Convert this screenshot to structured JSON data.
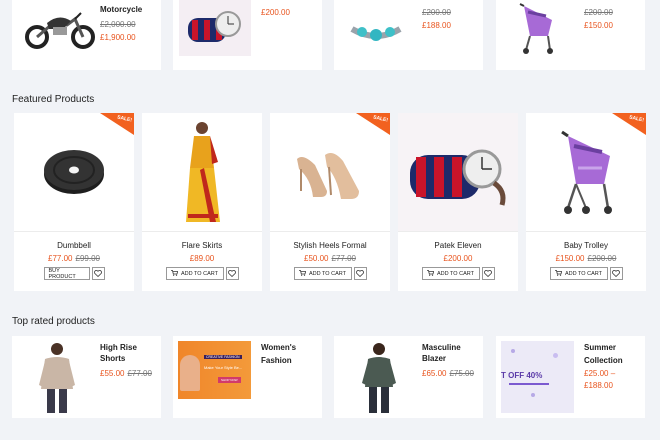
{
  "top_row": [
    {
      "name": "Motorcycle",
      "price": "£1,900.00",
      "old_price": "£2,000.00",
      "icon": "motorcycle"
    },
    {
      "name": "",
      "price": "£200.00",
      "old_price": "",
      "icon": "watch-bag"
    },
    {
      "name": "",
      "price": "£188.00",
      "old_price": "£200.00",
      "icon": "bracelet"
    },
    {
      "name": "",
      "price": "£150.00",
      "old_price": "£200.00",
      "icon": "baby-trolley"
    }
  ],
  "featured": {
    "title": "Featured Products",
    "sale_label": "SALE!",
    "items": [
      {
        "name": "Dumbbell",
        "price": "£77.00",
        "old_price": "£99.00",
        "button": "BUY PRODUCT",
        "sale": true,
        "icon": "weight-plate"
      },
      {
        "name": "Flare Skirts",
        "price": "£89.00",
        "old_price": "",
        "button": "ADD TO CART",
        "sale": false,
        "icon": "saree"
      },
      {
        "name": "Stylish Heels Formal",
        "price": "£50.00",
        "old_price": "£77.00",
        "button": "ADD TO CART",
        "sale": true,
        "icon": "heels"
      },
      {
        "name": "Patek Eleven",
        "price": "£200.00",
        "old_price": "",
        "button": "ADD TO CART",
        "sale": false,
        "icon": "watch-bag"
      },
      {
        "name": "Baby Trolley",
        "price": "£150.00",
        "old_price": "£200.00",
        "button": "ADD TO CART",
        "sale": true,
        "icon": "baby-trolley"
      }
    ]
  },
  "top_rated": {
    "title": "Top rated products",
    "items": [
      {
        "name": "High Rise Shorts",
        "price": "£55.00",
        "old_price": "£77.00",
        "icon": "woman-sweater"
      },
      {
        "name_line1": "Women's",
        "name_line2": "Fashion",
        "icon": "fashion-banner",
        "banner_tag": "CREATIVE FASHION",
        "banner_text": "Make Your Style Be...",
        "banner_button": "SHOP NOW"
      },
      {
        "name": "Masculine Blazer",
        "price": "£65.00",
        "old_price": "£75.00",
        "icon": "woman-top"
      },
      {
        "name_line1": "Summer",
        "name_line2": "Collection",
        "price": "£25.00 –",
        "price2": "£188.00",
        "icon": "summer-banner",
        "banner_text": "T OFF 40%"
      }
    ]
  },
  "colors": {
    "accent": "#e8541e",
    "sale_badge": "#f2611f",
    "background": "#f1f3f7"
  }
}
